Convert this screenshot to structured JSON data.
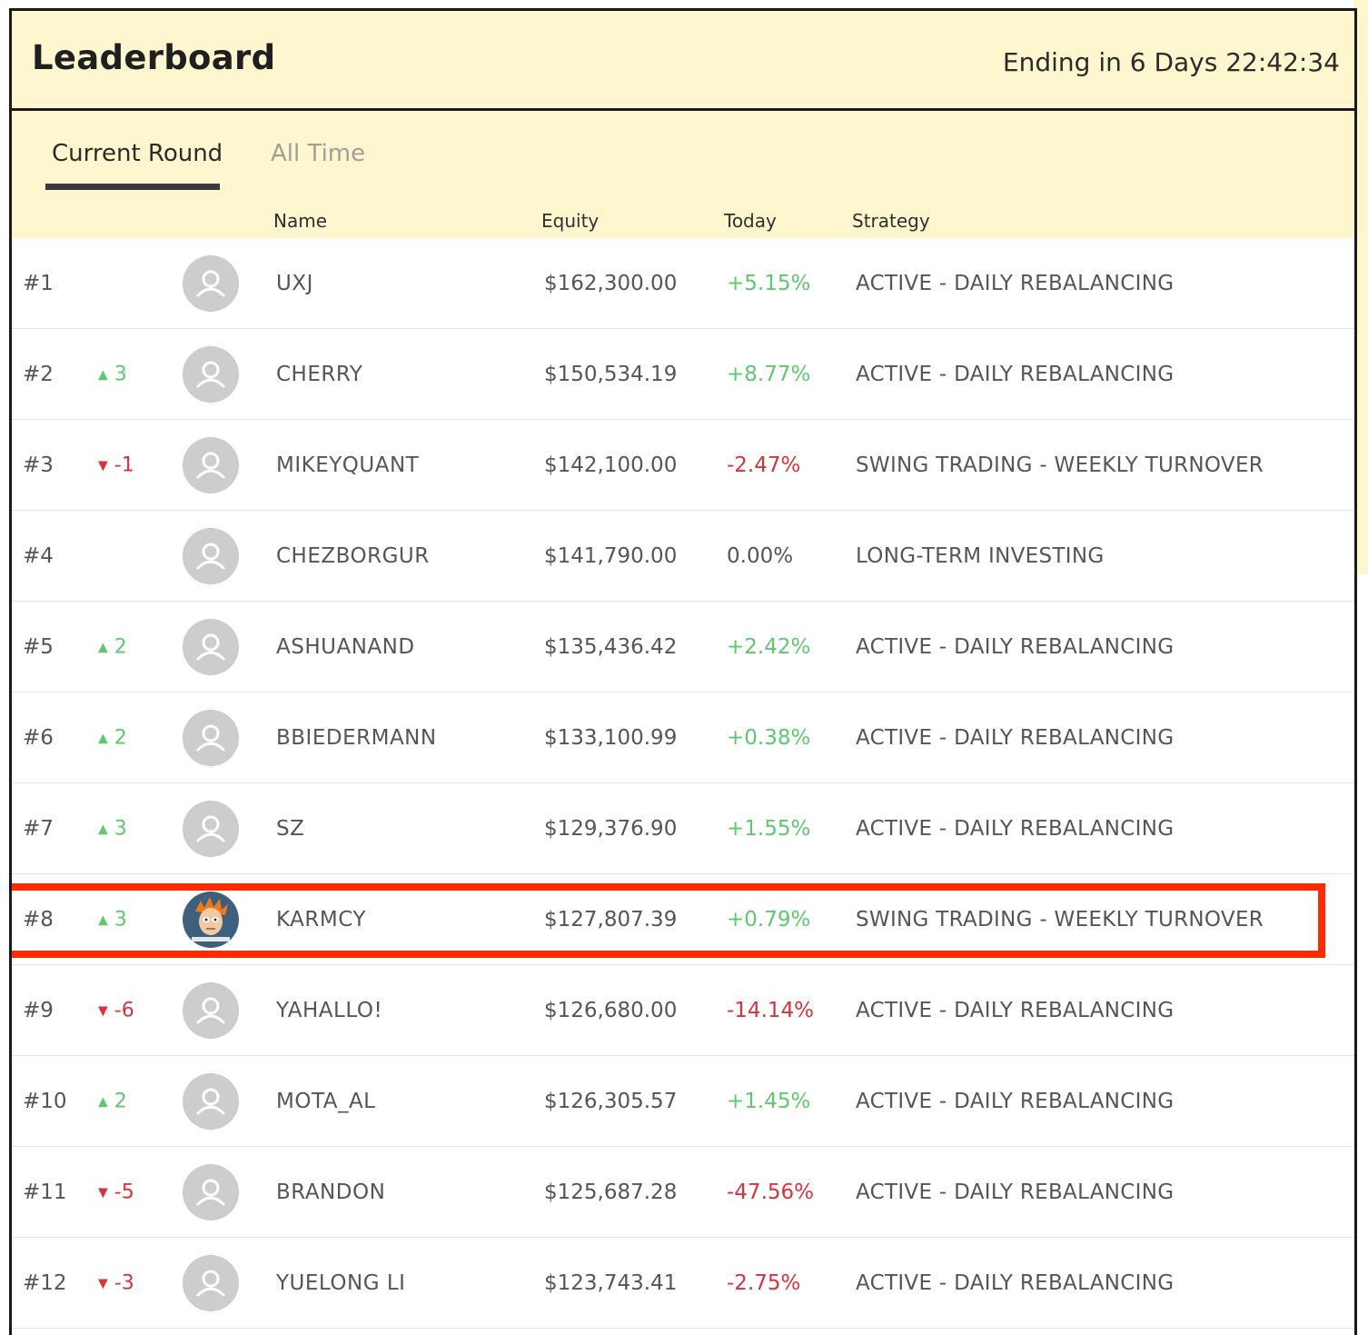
{
  "header": {
    "title": "Leaderboard",
    "countdown": "Ending in 6 Days 22:42:34"
  },
  "tabs": [
    {
      "label": "Current Round",
      "active": true
    },
    {
      "label": "All Time",
      "active": false
    }
  ],
  "columns": {
    "name": "Name",
    "equity": "Equity",
    "today": "Today",
    "strategy": "Strategy"
  },
  "colors": {
    "header_bg": "#fef6ce",
    "up": "#5fc86e",
    "down": "#d8323c",
    "highlight": "#ff2a00"
  },
  "rows": [
    {
      "rank": "#1",
      "delta": "",
      "direction": "none",
      "avatar": "default-avatar",
      "name": "UXJ",
      "equity": "$162,300.00",
      "today": "+5.15%",
      "trend": "up",
      "strategy": "ACTIVE - DAILY REBALANCING"
    },
    {
      "rank": "#2",
      "delta": "3",
      "direction": "up",
      "avatar": "default-avatar",
      "name": "CHERRY",
      "equity": "$150,534.19",
      "today": "+8.77%",
      "trend": "up",
      "strategy": "ACTIVE - DAILY REBALANCING"
    },
    {
      "rank": "#3",
      "delta": "-1",
      "direction": "down",
      "avatar": "default-avatar",
      "name": "MIKEYQUANT",
      "equity": "$142,100.00",
      "today": "-2.47%",
      "trend": "down",
      "strategy": "SWING TRADING - WEEKLY TURNOVER"
    },
    {
      "rank": "#4",
      "delta": "",
      "direction": "none",
      "avatar": "default-avatar",
      "name": "CHEZBORGUR",
      "equity": "$141,790.00",
      "today": "0.00%",
      "trend": "flat",
      "strategy": "LONG-TERM INVESTING"
    },
    {
      "rank": "#5",
      "delta": "2",
      "direction": "up",
      "avatar": "default-avatar",
      "name": "ASHUANAND",
      "equity": "$135,436.42",
      "today": "+2.42%",
      "trend": "up",
      "strategy": "ACTIVE - DAILY REBALANCING"
    },
    {
      "rank": "#6",
      "delta": "2",
      "direction": "up",
      "avatar": "default-avatar",
      "name": "BBIEDERMANN",
      "equity": "$133,100.99",
      "today": "+0.38%",
      "trend": "up",
      "strategy": "ACTIVE - DAILY REBALANCING"
    },
    {
      "rank": "#7",
      "delta": "3",
      "direction": "up",
      "avatar": "default-avatar",
      "name": "SZ",
      "equity": "$129,376.90",
      "today": "+1.55%",
      "trend": "up",
      "strategy": "ACTIVE - DAILY REBALANCING"
    },
    {
      "rank": "#8",
      "delta": "3",
      "direction": "up",
      "avatar": "custom-avatar",
      "name": "KARMCY",
      "equity": "$127,807.39",
      "today": "+0.79%",
      "trend": "up",
      "strategy": "SWING TRADING - WEEKLY TURNOVER",
      "highlighted": true
    },
    {
      "rank": "#9",
      "delta": "-6",
      "direction": "down",
      "avatar": "default-avatar",
      "name": "YAHALLO!",
      "equity": "$126,680.00",
      "today": "-14.14%",
      "trend": "down",
      "strategy": "ACTIVE - DAILY REBALANCING"
    },
    {
      "rank": "#10",
      "delta": "2",
      "direction": "up",
      "avatar": "default-avatar",
      "name": "MOTA_AL",
      "equity": "$126,305.57",
      "today": "+1.45%",
      "trend": "up",
      "strategy": "ACTIVE - DAILY REBALANCING"
    },
    {
      "rank": "#11",
      "delta": "-5",
      "direction": "down",
      "avatar": "default-avatar",
      "name": "BRANDON",
      "equity": "$125,687.28",
      "today": "-47.56%",
      "trend": "down",
      "strategy": "ACTIVE - DAILY REBALANCING"
    },
    {
      "rank": "#12",
      "delta": "-3",
      "direction": "down",
      "avatar": "default-avatar",
      "name": "YUELONG LI",
      "equity": "$123,743.41",
      "today": "-2.75%",
      "trend": "down",
      "strategy": "ACTIVE - DAILY REBALANCING"
    }
  ]
}
